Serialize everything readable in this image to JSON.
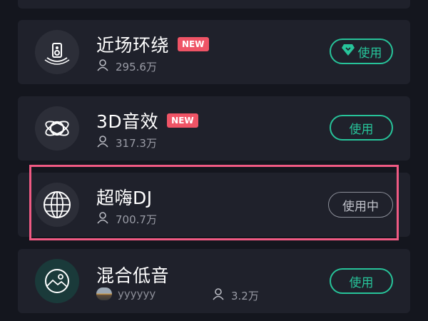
{
  "items": [
    {
      "title": "近场环绕",
      "badge": "NEW",
      "count": "295.6万",
      "button": "使用",
      "icon": "speaker-icon",
      "premium": true
    },
    {
      "title": "3D音效",
      "badge": "NEW",
      "count": "317.3万",
      "button": "使用",
      "icon": "atom-orbit-icon"
    },
    {
      "title": "超嗨DJ",
      "count": "700.7万",
      "button": "使用中",
      "icon": "globe-icon",
      "selected": true
    },
    {
      "title": "混合低音",
      "author": "yyyyyy",
      "count": "3.2万",
      "button": "使用",
      "icon": "landscape-icon"
    }
  ],
  "colors": {
    "accent": "#27c49a",
    "badge": "#ef5466",
    "highlight": "#f05a83",
    "card": "#1f212b",
    "background": "#14161e"
  }
}
